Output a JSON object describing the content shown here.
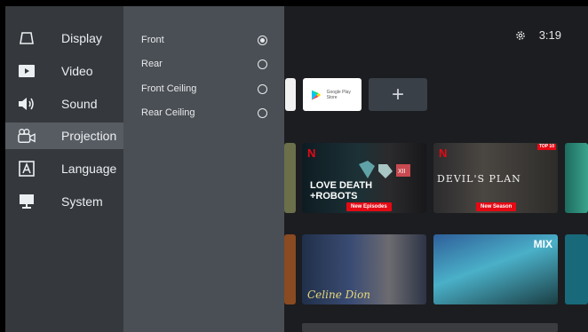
{
  "status": {
    "time": "3:19",
    "settings_icon": "gear-icon"
  },
  "apps": {
    "google_play_label": "Google Play Store",
    "add_icon": "+"
  },
  "content": {
    "love_death_robots": {
      "logo": "N",
      "title_line1": "LOVE DEATH",
      "title_line2": "+ROBOTS",
      "badge": "New Episodes"
    },
    "devils_plan": {
      "logo": "N",
      "title": "DEVIL'S PLAN",
      "badge": "New Season",
      "top10": "TOP 10"
    },
    "celine_dion": {
      "title": "Celine Dion"
    },
    "mix": {
      "title": "MIX"
    }
  },
  "menu": {
    "items": [
      {
        "label": "Display",
        "icon": "display-icon"
      },
      {
        "label": "Video",
        "icon": "video-icon"
      },
      {
        "label": "Sound",
        "icon": "sound-icon"
      },
      {
        "label": "Projection",
        "icon": "projection-icon",
        "selected": true
      },
      {
        "label": "Language",
        "icon": "language-icon"
      },
      {
        "label": "System",
        "icon": "system-icon"
      }
    ]
  },
  "projection_options": [
    {
      "label": "Front",
      "checked": true
    },
    {
      "label": "Rear",
      "checked": false
    },
    {
      "label": "Front Ceiling",
      "checked": false
    },
    {
      "label": "Rear Ceiling",
      "checked": false
    }
  ]
}
